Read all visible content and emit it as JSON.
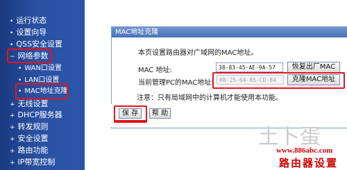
{
  "sidebar": {
    "items": [
      {
        "label": "运行状态"
      },
      {
        "label": "设置向导"
      },
      {
        "label": "QSS安全设置"
      },
      {
        "label": "网络参数"
      },
      {
        "label": "WAN口设置"
      },
      {
        "label": "LAN口设置"
      },
      {
        "label": "MAC地址克隆"
      },
      {
        "label": "无线设置"
      },
      {
        "label": "DHCP服务器"
      },
      {
        "label": "转发规则"
      },
      {
        "label": "安全设置"
      },
      {
        "label": "路由功能"
      },
      {
        "label": "IP带宽控制"
      }
    ]
  },
  "panel": {
    "title": "MAC地址克隆",
    "description": "本页设置路由器对广域网的MAC地址。",
    "mac_label": "MAC 地址:",
    "mac_value": "38-83-45-AE-9A-57",
    "restore_button": "恢复出厂MAC",
    "pc_mac_label": "当前管理PC的MAC地址:",
    "pc_mac_value": "00-25-64-85-CD-84",
    "clone_button": "克隆MAC地址",
    "note": "注意：只有局域网中的计算机才能使用本功能。",
    "save_button": "保 存",
    "help_button": "帮 助"
  },
  "watermark": {
    "text": "土卜蛋",
    "url": "www.886abc.com",
    "name": "路由器设置"
  },
  "colors": {
    "sidebar_bg": "#2a51a3",
    "highlight_red": "#e0161d",
    "panel_title_bg": "#5b80c4",
    "site_red": "#d00000"
  }
}
